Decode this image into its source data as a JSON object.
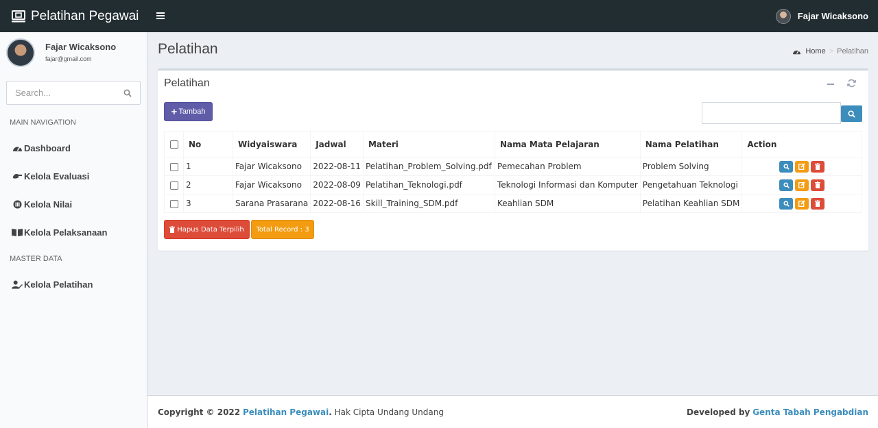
{
  "header": {
    "brand": "Pelatihan Pegawai",
    "user_name": "Fajar Wicaksono"
  },
  "sidebar": {
    "user": {
      "name": "Fajar Wicaksono",
      "email": "fajar@gmail.com"
    },
    "search_placeholder": "Search...",
    "sections": [
      {
        "title": "MAIN NAVIGATION",
        "items": [
          "Dashboard",
          "Kelola Evaluasi",
          "Kelola Nilai",
          "Kelola Pelaksanaan"
        ]
      },
      {
        "title": "MASTER DATA",
        "items": [
          "Kelola Pelatihan"
        ]
      }
    ]
  },
  "page": {
    "title": "Pelatihan",
    "breadcrumb": [
      "Home",
      "Pelatihan"
    ]
  },
  "box": {
    "title": "Pelatihan",
    "add_button": "Tambah",
    "search_value": "",
    "table": {
      "headers": [
        "No",
        "Widyaiswara",
        "Jadwal",
        "Materi",
        "Nama Mata Pelajaran",
        "Nama Pelatihan",
        "Action"
      ],
      "rows": [
        [
          "1",
          "Fajar Wicaksono",
          "2022-08-11",
          "Pelatihan_Problem_Solving.pdf",
          "Pemecahan Problem",
          "Problem Solving"
        ],
        [
          "2",
          "Fajar Wicaksono",
          "2022-08-09",
          "Pelatihan_Teknologi.pdf",
          "Teknologi Informasi dan Komputer",
          "Pengetahuan Teknologi"
        ],
        [
          "3",
          "Sarana Prasarana",
          "2022-08-16",
          "Skill_Training_SDM.pdf",
          "Keahlian SDM",
          "Pelatihan Keahlian SDM"
        ]
      ]
    },
    "delete_selected_button": "Hapus Data Terpilih",
    "total_record": "Total Record : 3"
  },
  "footer": {
    "copyright_prefix": "Copyright © 2022",
    "app_name": "Pelatihan Pegawai",
    "rights": "Hak Cipta Undang Undang",
    "developed_by": "Developed by",
    "developer": "Genta Tabah Pengabdian"
  },
  "colors": {
    "topbar": "#222d32",
    "primary": "#3c8dbc",
    "purple": "#605ca8",
    "warning": "#f39c12",
    "danger": "#dd4b39"
  }
}
